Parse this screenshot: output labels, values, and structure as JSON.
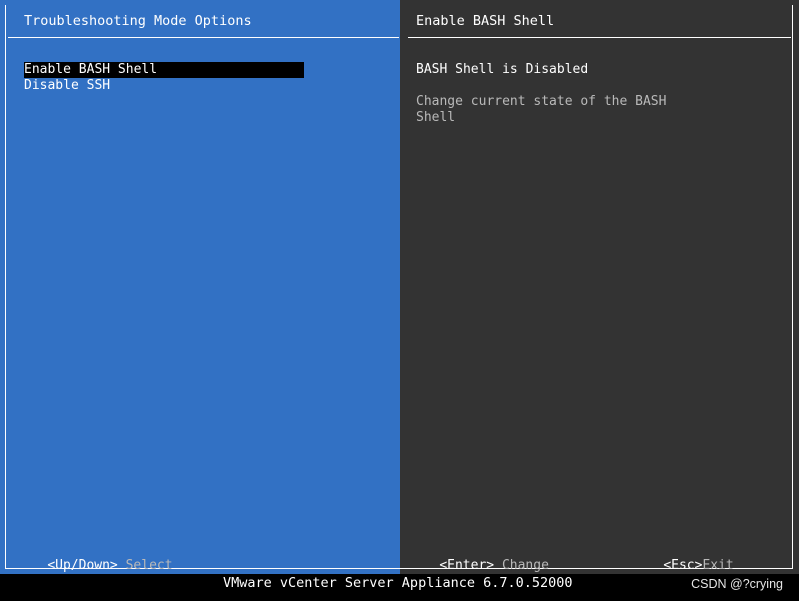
{
  "left_panel": {
    "title": "Troubleshooting Mode Options",
    "menu": [
      {
        "label": "Enable BASH Shell",
        "selected": true
      },
      {
        "label": "Disable SSH",
        "selected": false
      }
    ]
  },
  "right_panel": {
    "title": "Enable BASH Shell",
    "status": "BASH Shell is Disabled",
    "description_line1": "Change current state of the BASH",
    "description_line2": "Shell"
  },
  "hotkeys": {
    "updown_key": "<Up/Down>",
    "updown_action": "Select",
    "enter_key": "<Enter>",
    "enter_action": "Change",
    "esc_key": "<Esc>",
    "esc_action": "Exit"
  },
  "footer": {
    "product": "VMware vCenter Server Appliance 6.7.0.52000",
    "watermark": "CSDN @?crying"
  },
  "colors": {
    "left_bg": "#3271c4",
    "right_bg": "#333333",
    "selection_bg": "#000000",
    "text": "#ffffff",
    "dim_text": "#b9b9b9"
  }
}
